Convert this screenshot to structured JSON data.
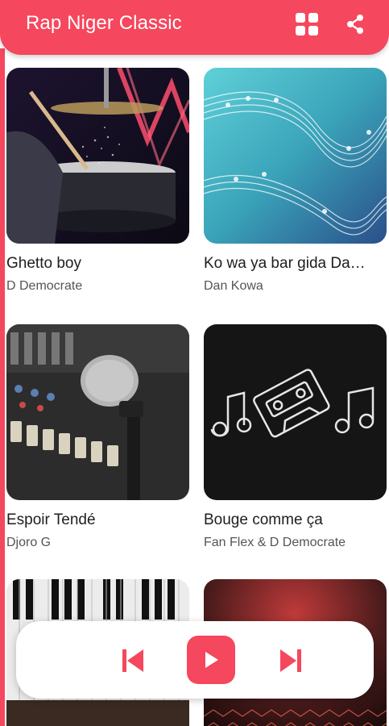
{
  "app": {
    "title": "Rap Niger Classic",
    "accent_color": "#f5475d",
    "grid_icon": "grid-view-icon",
    "share_icon": "share-icon"
  },
  "songs": [
    {
      "title": "Ghetto boy",
      "artist": "D Democrate",
      "thumbnail": "drum-kit"
    },
    {
      "title": "Ko wa ya bar gida Da…",
      "artist": "Dan Kowa",
      "thumbnail": "music-notes-staff"
    },
    {
      "title": "Espoir Tendé",
      "artist": "Djoro G",
      "thumbnail": "microphone-mixer"
    },
    {
      "title": "Bouge comme ça",
      "artist": "Fan Flex & D Democrate",
      "thumbnail": "cassette-chalkboard"
    },
    {
      "title": "",
      "artist": "",
      "thumbnail": "piano-keys"
    },
    {
      "title": "",
      "artist": "",
      "thumbnail": "red-hexagon-lights"
    }
  ],
  "player": {
    "prev_icon": "skip-previous-icon",
    "play_icon": "play-icon",
    "next_icon": "skip-next-icon"
  }
}
